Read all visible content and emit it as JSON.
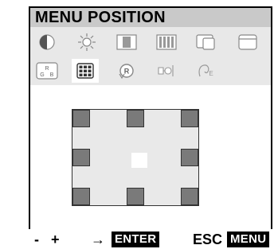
{
  "menu": {
    "title": "MENU POSITION"
  },
  "icons_row1": [
    {
      "name": "contrast-icon"
    },
    {
      "name": "brightness-icon"
    },
    {
      "name": "h-size-icon"
    },
    {
      "name": "v-size-icon"
    },
    {
      "name": "h-position-icon"
    },
    {
      "name": "v-position-icon"
    }
  ],
  "icons_row2": [
    {
      "name": "color-rgb-icon",
      "label": "R\nG B"
    },
    {
      "name": "menu-position-icon",
      "selected": true
    },
    {
      "name": "recall-icon",
      "label": "R"
    },
    {
      "name": "degauss-icon"
    },
    {
      "name": "language-icon"
    }
  ],
  "position_grid": {
    "current": "center"
  },
  "footer": {
    "minus": "-",
    "plus": "+",
    "arrow": "→",
    "enter": "ENTER",
    "esc": "ESC",
    "menu": "MENU"
  }
}
